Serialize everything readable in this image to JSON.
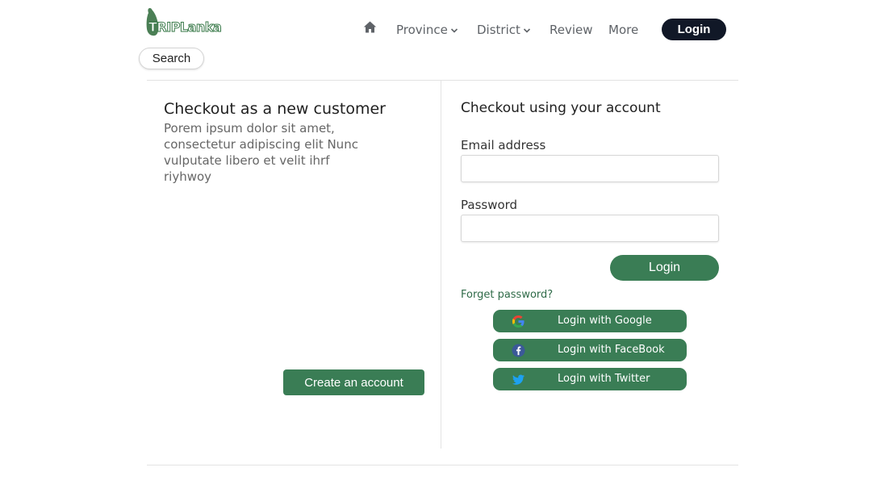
{
  "header": {
    "logo_text": "TRIPLanka",
    "nav": {
      "province": "Province",
      "district": "District",
      "review": "Review",
      "more": "More"
    },
    "login_label": "Login",
    "search_label": "Search"
  },
  "new_customer": {
    "title": "Checkout as a new customer",
    "description": "Porem ipsum dolor sit amet, consectetur adipiscing elit Nunc vulputate libero et velit ihrf riyhwoy",
    "create_label": "Create an account"
  },
  "account": {
    "title": "Checkout using your account",
    "email_label": "Email address",
    "email_value": "",
    "password_label": "Password",
    "password_value": "",
    "login_label": "Login",
    "forget_label": "Forget password?",
    "social": {
      "google": "Login with Google",
      "facebook": "Login with FaceBook",
      "twitter": "Login with Twitter"
    }
  },
  "colors": {
    "primary_green": "#3a7d55",
    "dark_button": "#111827",
    "link_green": "#2f6b48"
  },
  "icons": {
    "home": "home-icon",
    "chevron": "chevron-down-icon",
    "google": "google-icon",
    "facebook": "facebook-icon",
    "twitter": "twitter-icon"
  }
}
